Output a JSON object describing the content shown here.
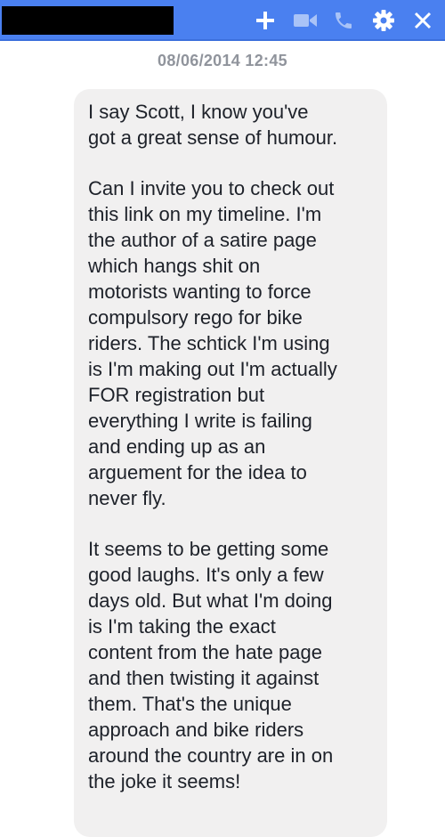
{
  "titlebar": {
    "background": "#4a80f0",
    "contact_name": "",
    "icons": [
      "add-icon",
      "video-call-icon",
      "phone-call-icon",
      "settings-icon",
      "close-icon"
    ]
  },
  "conversation": {
    "timestamp": "08/06/2014 12:45",
    "message": {
      "paragraphs": [
        "I say Scott,  I know you've\ngot a great sense of humour.",
        "Can I invite you to check out\nthis link on my timeline.  I'm\nthe author of a satire page\nwhich hangs shit on\nmotorists wanting to force\ncompulsory rego for bike\nriders.  The schtick I'm using\nis I'm making out I'm actually\nFOR registration but\neverything I write is failing\nand ending up as an\narguement for the idea to\nnever fly.",
        "It seems to be getting some\ngood laughs.  It's only a few\ndays old.  But what I'm doing\nis I'm taking the exact\ncontent from the hate page\nand then twisting it against\nthem.  That's the unique\napproach and bike riders\naround the country are in on\nthe joke it seems!"
      ]
    }
  }
}
